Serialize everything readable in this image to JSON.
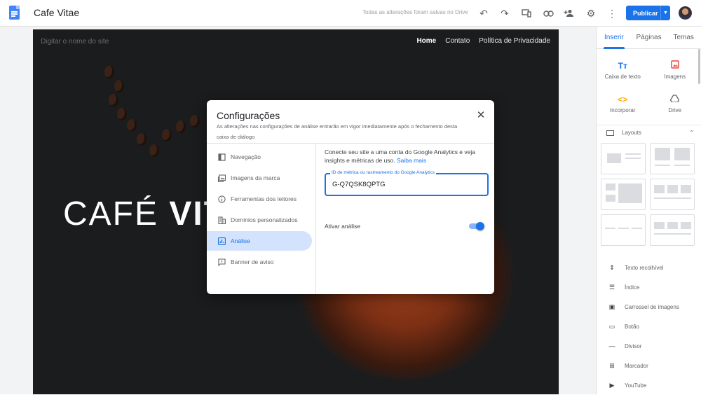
{
  "topbar": {
    "site_title": "Cafe Vitae",
    "save_status": "Todas as alterações foram salvas no Drive",
    "publish_label": "Publicar",
    "icons": [
      "undo-icon",
      "redo-icon",
      "device-preview-icon",
      "link-icon",
      "share-add-person-icon",
      "settings-gear-icon",
      "more-vert-icon"
    ]
  },
  "site": {
    "name_placeholder": "Digitar o nome do site",
    "nav": [
      "Home",
      "Contato",
      "Política de Privacidade"
    ],
    "hero_title_light": "CAFÉ ",
    "hero_title_bold": "VIT"
  },
  "right_panel": {
    "tabs": [
      "Inserir",
      "Páginas",
      "Temas"
    ],
    "insert_items": [
      {
        "label": "Caixa de texto",
        "icon": "text-box-icon"
      },
      {
        "label": "Imagens",
        "icon": "images-icon"
      },
      {
        "label": "Incorporar",
        "icon": "embed-icon"
      },
      {
        "label": "Drive",
        "icon": "drive-icon"
      }
    ],
    "layouts_label": "Layouts",
    "components": [
      {
        "label": "Texto recolhível",
        "icon": "collapsible-text-icon"
      },
      {
        "label": "Índice",
        "icon": "table-of-contents-icon"
      },
      {
        "label": "Carrossel de imagens",
        "icon": "image-carousel-icon"
      },
      {
        "label": "Botão",
        "icon": "button-icon"
      },
      {
        "label": "Divisor",
        "icon": "divider-icon"
      },
      {
        "label": "Marcador",
        "icon": "placeholder-icon"
      },
      {
        "label": "YouTube",
        "icon": "youtube-icon"
      }
    ]
  },
  "dialog": {
    "title": "Configurações",
    "subtitle": "As alterações nas configurações de análise entrarão em vigor imediatamente após o fechamento desta caixa de diálogo",
    "nav": [
      {
        "label": "Navegação",
        "icon": "navigation-icon"
      },
      {
        "label": "Imagens da marca",
        "icon": "brand-images-icon"
      },
      {
        "label": "Ferramentas dos leitores",
        "icon": "info-icon"
      },
      {
        "label": "Domínios personalizados",
        "icon": "domain-icon"
      },
      {
        "label": "Análise",
        "icon": "analytics-icon"
      },
      {
        "label": "Banner de aviso",
        "icon": "announcement-icon"
      }
    ],
    "active_nav": "Análise",
    "ga_description": "Conecte seu site a uma conta do Google Analytics e veja insights e métricas de uso.",
    "ga_link": "Saiba mais",
    "field_label": "ID de métrica ou rastreamento do Google Analytics",
    "field_value": "G-Q7QSK8QPTG",
    "toggle_label": "Ativar análise",
    "toggle_on": true
  },
  "colors": {
    "accent": "#1a73e8",
    "active_nav_bg": "#d3e3fd",
    "hero_bg": "#1b1c1e"
  }
}
